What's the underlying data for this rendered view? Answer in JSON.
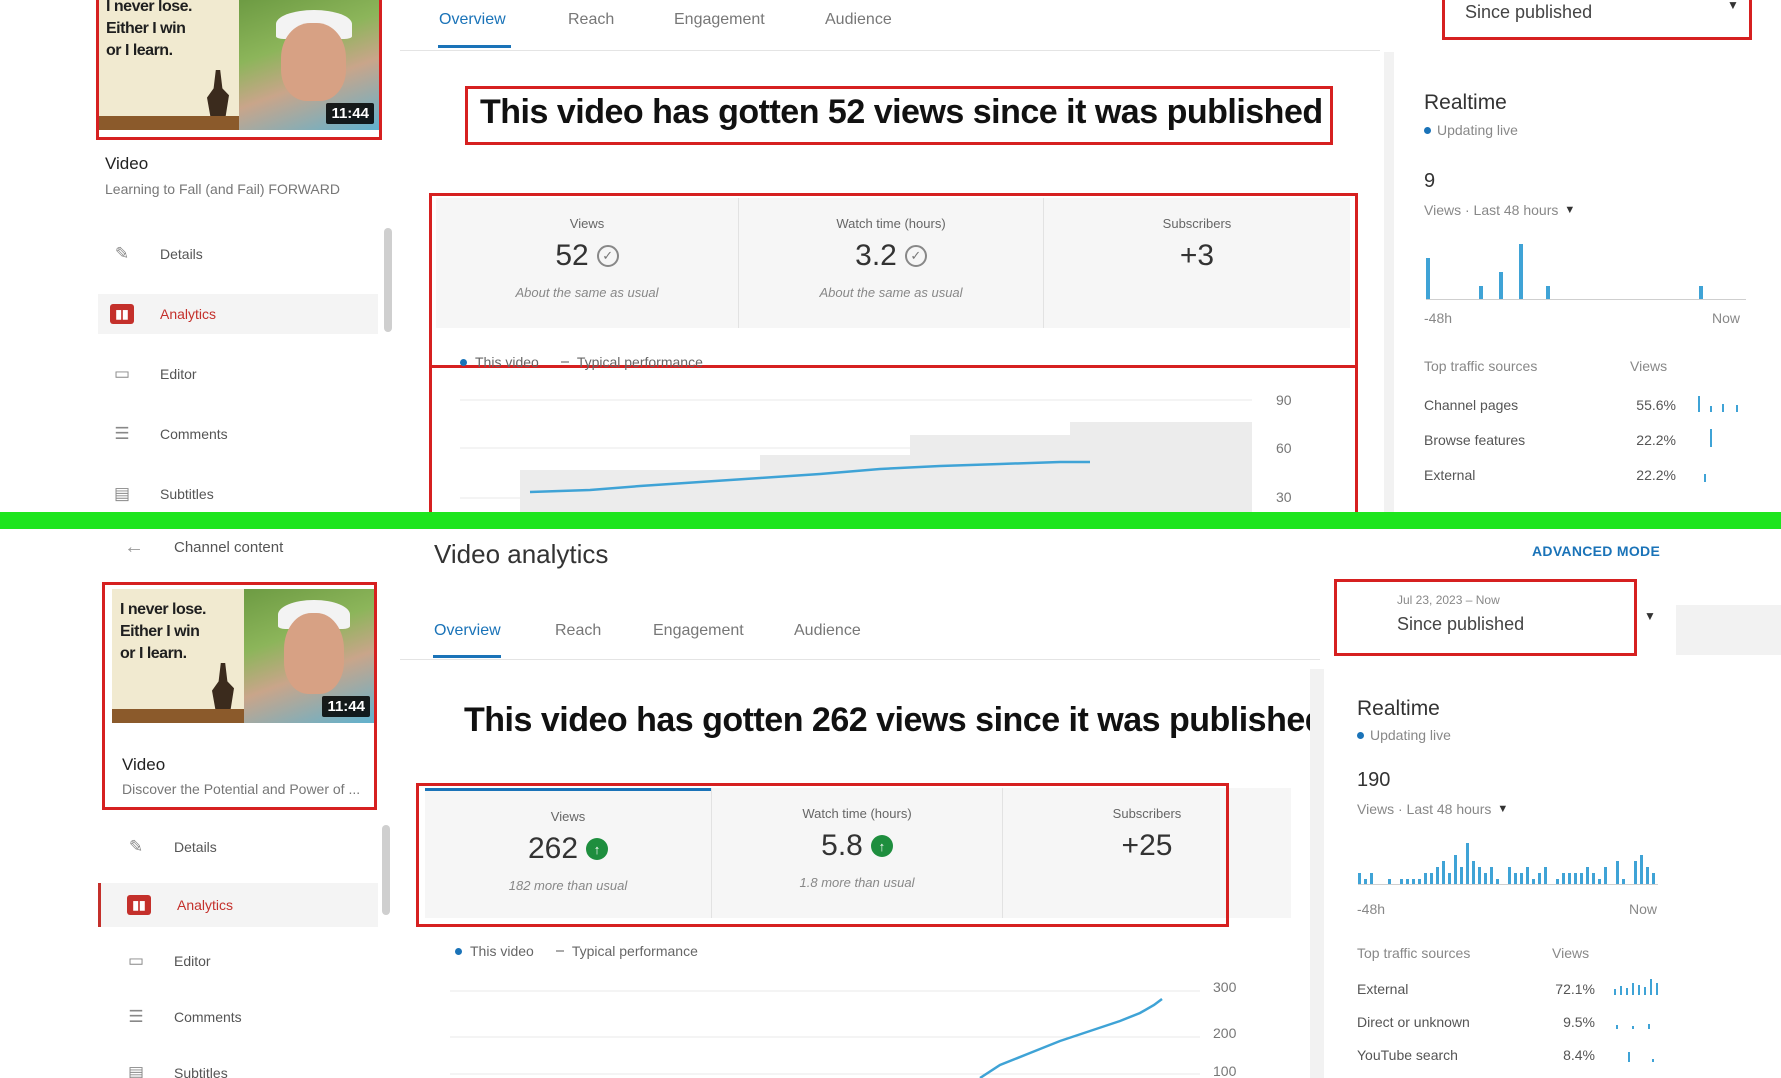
{
  "top": {
    "thumbnail": {
      "lines": [
        "I never lose.",
        "Either I win",
        "or I learn."
      ],
      "duration": "11:44"
    },
    "video_label": "Video",
    "video_title": "Learning to Fall (and Fail) FORWARD",
    "nav": [
      "Details",
      "Analytics",
      "Editor",
      "Comments",
      "Subtitles"
    ],
    "tabs": [
      "Overview",
      "Reach",
      "Engagement",
      "Audience"
    ],
    "date_range": "Since published",
    "headline": "This video has gotten 52 views since it was published",
    "metrics": [
      {
        "label": "Views",
        "value": "52",
        "note": "About the same as usual"
      },
      {
        "label": "Watch time (hours)",
        "value": "3.2",
        "note": "About the same as usual"
      },
      {
        "label": "Subscribers",
        "value": "+3",
        "note": ""
      }
    ],
    "legend": {
      "this_video": "This video",
      "typical": "Typical performance"
    },
    "y_ticks": [
      "90",
      "60",
      "30"
    ],
    "realtime": {
      "title": "Realtime",
      "live": "Updating live",
      "count": "9",
      "period": "Views · Last 48 hours",
      "axis_start": "-48h",
      "axis_end": "Now",
      "bars": [
        3,
        0,
        0,
        0,
        0,
        0,
        0,
        0,
        1,
        0,
        0,
        2,
        0,
        0,
        4,
        0,
        0,
        0,
        1,
        0,
        0,
        0,
        0,
        0,
        0,
        0,
        0,
        0,
        0,
        0,
        0,
        0,
        0,
        0,
        0,
        0,
        0,
        0,
        0,
        0,
        0,
        1,
        0,
        0,
        0,
        0,
        0,
        0
      ]
    },
    "traffic": {
      "header": "Top traffic sources",
      "views_header": "Views",
      "rows": [
        {
          "source": "Channel pages",
          "pct": "55.6%"
        },
        {
          "source": "Browse features",
          "pct": "22.2%"
        },
        {
          "source": "External",
          "pct": "22.2%"
        }
      ]
    }
  },
  "bottom": {
    "back_label": "Channel content",
    "page_title": "Video analytics",
    "advanced_mode": "ADVANCED MODE",
    "thumbnail": {
      "lines": [
        "I never lose.",
        "Either I win",
        "or I learn."
      ],
      "duration": "11:44"
    },
    "video_label": "Video",
    "video_title": "Discover the Potential and Power of ...",
    "nav": [
      "Details",
      "Analytics",
      "Editor",
      "Comments",
      "Subtitles"
    ],
    "tabs": [
      "Overview",
      "Reach",
      "Engagement",
      "Audience"
    ],
    "date_sub": "Jul 23, 2023 – Now",
    "date_range": "Since published",
    "headline": "This video has gotten 262 views since it was published",
    "metrics": [
      {
        "label": "Views",
        "value": "262",
        "note": "182 more than usual"
      },
      {
        "label": "Watch time (hours)",
        "value": "5.8",
        "note": "1.8 more than usual"
      },
      {
        "label": "Subscribers",
        "value": "+25",
        "note": ""
      }
    ],
    "legend": {
      "this_video": "This video",
      "typical": "Typical performance"
    },
    "y_ticks": [
      "300",
      "200",
      "100"
    ],
    "realtime": {
      "title": "Realtime",
      "live": "Updating live",
      "count": "190",
      "period": "Views · Last 48 hours",
      "axis_start": "-48h",
      "axis_end": "Now",
      "bars": [
        2,
        1,
        2,
        0,
        0,
        1,
        0,
        1,
        1,
        1,
        1,
        2,
        2,
        3,
        4,
        2,
        5,
        3,
        7,
        4,
        3,
        2,
        3,
        1,
        0,
        3,
        2,
        2,
        3,
        1,
        2,
        3,
        0,
        1,
        2,
        2,
        2,
        2,
        3,
        2,
        1,
        3,
        0,
        4,
        1,
        0,
        4,
        5,
        3,
        2
      ]
    },
    "traffic": {
      "header": "Top traffic sources",
      "views_header": "Views",
      "rows": [
        {
          "source": "External",
          "pct": "72.1%"
        },
        {
          "source": "Direct or unknown",
          "pct": "9.5%"
        },
        {
          "source": "YouTube search",
          "pct": "8.4%"
        }
      ]
    }
  }
}
